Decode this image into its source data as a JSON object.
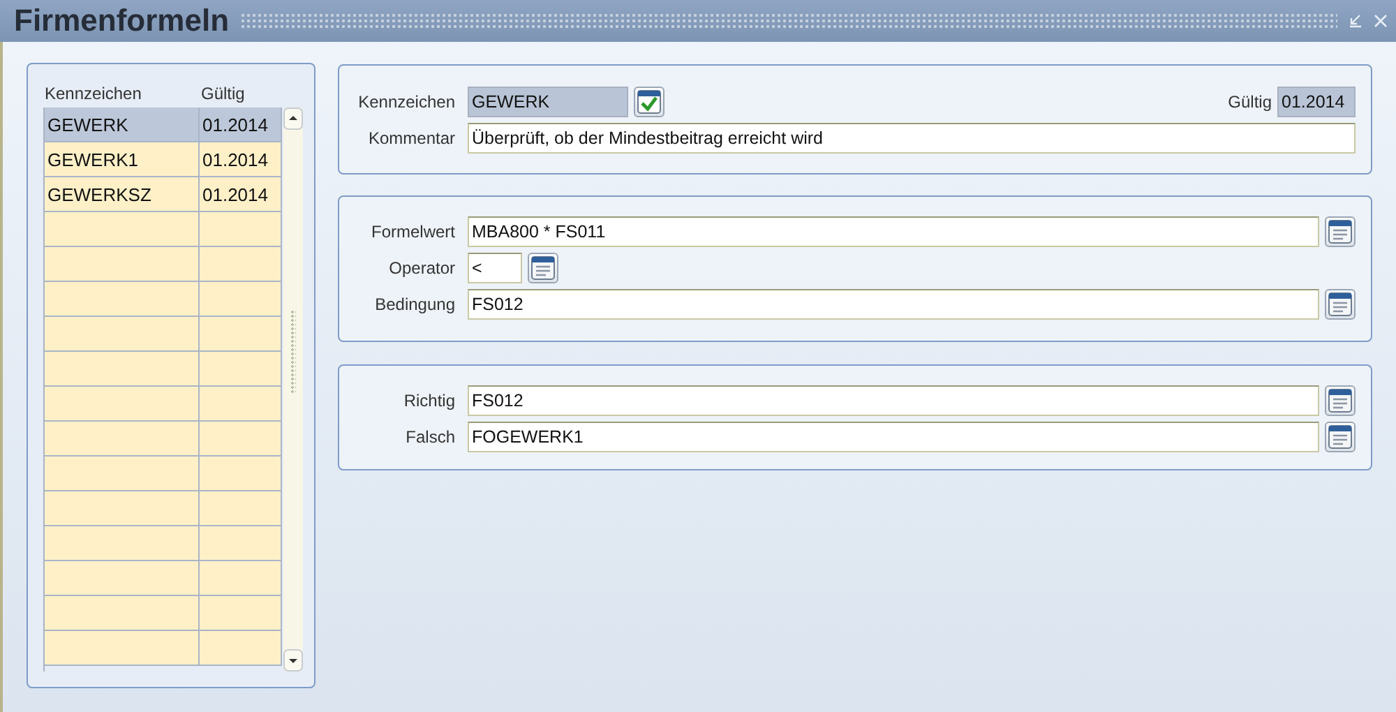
{
  "window": {
    "title": "Firmenformeln"
  },
  "list": {
    "columns": [
      "Kennzeichen",
      "Gültig"
    ],
    "rows": [
      {
        "cells": [
          "GEWERK",
          "01.2014"
        ],
        "selected": true
      },
      {
        "cells": [
          "GEWERK1",
          "01.2014"
        ],
        "selected": false
      },
      {
        "cells": [
          "GEWERKSZ",
          "01.2014"
        ],
        "selected": false
      }
    ]
  },
  "panels": [
    {
      "rows": [
        [
          {
            "kind": "code",
            "label": "Kennzeichen",
            "value": "GEWERK",
            "readonly": true
          },
          {
            "kind": "date",
            "label": "Gültig",
            "value": "01.2014",
            "readonly": true
          }
        ],
        [
          {
            "kind": "comment",
            "label": "Kommentar",
            "value": "Überprüft, ob der Mindestbeitrag erreicht wird",
            "readonly": false
          }
        ]
      ]
    },
    {
      "rows": [
        [
          {
            "kind": "formula",
            "label": "Formelwert",
            "value": "MBA800 * FS011",
            "readonly": false
          }
        ],
        [
          {
            "kind": "operator",
            "label": "Operator",
            "value": "<",
            "readonly": false
          }
        ],
        [
          {
            "kind": "formula",
            "label": "Bedingung",
            "value": "FS012",
            "readonly": false
          }
        ]
      ]
    },
    {
      "rows": [
        [
          {
            "kind": "formula",
            "label": "Richtig",
            "value": "FS012",
            "readonly": false
          }
        ],
        [
          {
            "kind": "formula",
            "label": "Falsch",
            "value": "FOGEWERK1",
            "readonly": false
          }
        ]
      ]
    }
  ]
}
